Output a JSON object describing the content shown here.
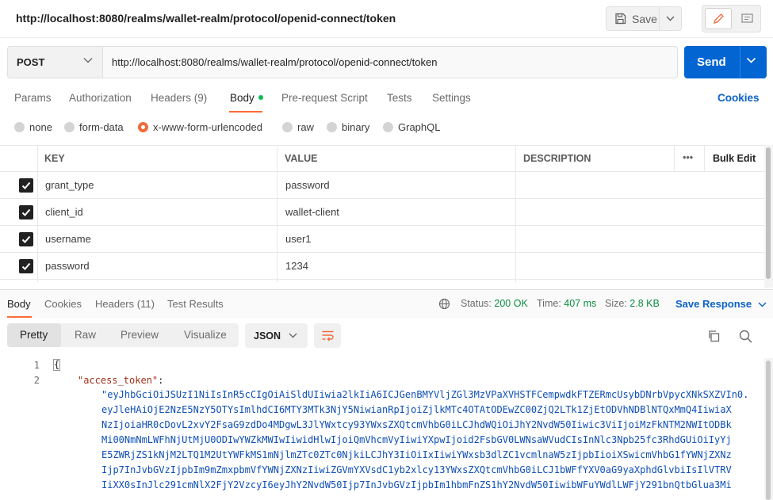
{
  "header": {
    "title_url": "http://localhost:8080/realms/wallet-realm/protocol/openid-connect/token",
    "save_label": "Save"
  },
  "request": {
    "method": "POST",
    "url": "http://localhost:8080/realms/wallet-realm/protocol/openid-connect/token",
    "send_label": "Send"
  },
  "tabs": [
    {
      "label": "Params"
    },
    {
      "label": "Authorization"
    },
    {
      "label": "Headers (9)"
    },
    {
      "label": "Body"
    },
    {
      "label": "Pre-request Script"
    },
    {
      "label": "Tests"
    },
    {
      "label": "Settings"
    }
  ],
  "active_tab": "Body",
  "cookies_label": "Cookies",
  "body_types": [
    {
      "label": "none",
      "selected": false
    },
    {
      "label": "form-data",
      "selected": false
    },
    {
      "label": "x-www-form-urlencoded",
      "selected": true
    },
    {
      "label": "raw",
      "selected": false
    },
    {
      "label": "binary",
      "selected": false
    },
    {
      "label": "GraphQL",
      "selected": false
    }
  ],
  "params": {
    "headers": {
      "key": "KEY",
      "value": "VALUE",
      "description": "DESCRIPTION",
      "more": "•••",
      "bulk_edit": "Bulk Edit"
    },
    "rows": [
      {
        "key": "grant_type",
        "value": "password",
        "checked": true
      },
      {
        "key": "client_id",
        "value": "wallet-client",
        "checked": true
      },
      {
        "key": "username",
        "value": "user1",
        "checked": true
      },
      {
        "key": "password",
        "value": "1234",
        "checked": true
      }
    ]
  },
  "response": {
    "tabs": [
      {
        "label": "Body"
      },
      {
        "label": "Cookies"
      },
      {
        "label": "Headers (11)"
      },
      {
        "label": "Test Results"
      }
    ],
    "status_label": "Status:",
    "status_value": "200 OK",
    "time_label": "Time:",
    "time_value": "407 ms",
    "size_label": "Size:",
    "size_value": "2.8 KB",
    "save_response": "Save Response",
    "views": [
      "Pretty",
      "Raw",
      "Preview",
      "Visualize"
    ],
    "format": "JSON",
    "code": {
      "line_numbers": [
        "1",
        "2"
      ],
      "open_brace": "{",
      "key": "\"access_token\"",
      "colon": ":",
      "value_lines": [
        "\"eyJhbGciOiJSUzI1NiIsInR5cCIgOiAiSldUIiwia2lkIiA6ICJGenBMYVljZGl3MzVPaXVHSTFCempwdkFTZERmcUsybDNrbVpycXNkSXZVIn0.",
        "eyJleHAiOjE2NzE5NzY5OTYsImlhdCI6MTY3MTk3NjY5NiwianRpIjoiZjlkMTc4OTAtODEwZC00ZjQ2LTk1ZjEtODVhNDBlNTQxMmQ4IiwiaX",
        "NzIjoiaHR0cDovL2xvY2FsaG9zdDo4MDgwL3JlYWxtcy93YWxsZXQtcmVhbG0iLCJhdWQiOiJhY2NvdW50Iiwic3ViIjoiMzFkNTM2NWItODBk",
        "Mi00NmNmLWFhNjUtMjU0ODIwYWZkMWIwIiwidHlwIjoiQmVhcmVyIiwiYXpwIjoid2FsbGV0LWNsaWVudCIsInNlc3Npb25fc3RhdGUiOiIyYj",
        "E5ZWRjZS1kNjM2LTQ1M2UtYWFkMS1mNjlmZTc0ZTc0NjkiLCJhY3IiOiIxIiwiYWxsb3dlZC1vcmlnaW5zIjpbIioiXSwicmVhbG1fYWNjZXNz",
        "Ijp7InJvbGVzIjpbIm9mZmxpbmVfYWNjZXNzIiwiZGVmYXVsdC1yb2xlcy13YWxsZXQtcmVhbG0iLCJ1bWFfYXV0aG9yaXphdGlvbiIsIlVTRV",
        "IiXX0sInJlc291cmNlX2FjY2VzcyI6eyJhY2NvdW50Ijp7InJvbGVzIjpbIm1hbmFnZS1hY2NvdW50IiwibWFuYWdlLWFjY291bnQtbGlua3Mi"
      ]
    }
  }
}
